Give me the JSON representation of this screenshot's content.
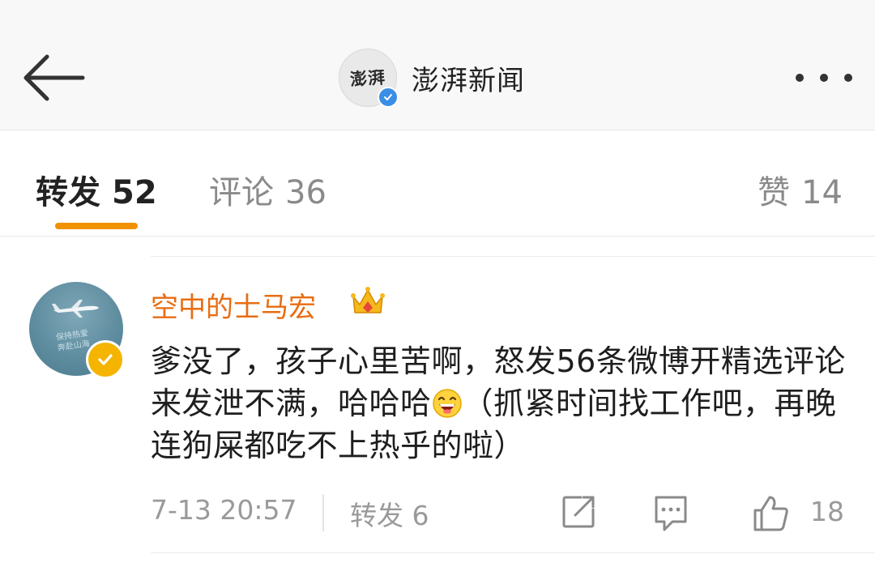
{
  "header": {
    "back_icon": "arrow-left-icon",
    "logo_text": "澎湃",
    "title": "澎湃新闻",
    "more_icon": "more-dots-icon"
  },
  "tabs": [
    {
      "label": "转发",
      "count": "52",
      "active": true
    },
    {
      "label": "评论",
      "count": "36",
      "active": false
    },
    {
      "label": "赞",
      "count": "14",
      "active": false
    }
  ],
  "comment": {
    "username": "空中的士马宏",
    "avatar_script": [
      "保持热爱",
      "奔赴山海"
    ],
    "text_before_emoji": "爹没了，孩子心里苦啊，怒发56条微博开精选评论来发泄不满，哈哈哈",
    "text_after_emoji": "（抓紧时间找工作吧，再晚连狗屎都吃不上热乎的啦）",
    "time": "7-13 20:57",
    "repost_label": "转发 6",
    "like_count": "18"
  },
  "colors": {
    "accent": "#f29100",
    "username": "#e86d12",
    "verified_blue": "#3b8ee6",
    "verified_gold": "#f4b400",
    "muted": "#9a9a9a"
  }
}
